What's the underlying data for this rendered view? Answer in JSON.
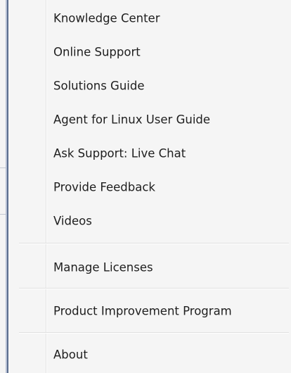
{
  "menu": {
    "groups": [
      {
        "items": [
          {
            "label": "Knowledge Center"
          },
          {
            "label": "Online Support"
          },
          {
            "label": "Solutions Guide"
          },
          {
            "label": "Agent for Linux User Guide"
          },
          {
            "label": "Ask Support: Live Chat"
          },
          {
            "label": "Provide Feedback"
          },
          {
            "label": "Videos"
          }
        ]
      },
      {
        "items": [
          {
            "label": "Manage Licenses"
          }
        ]
      },
      {
        "items": [
          {
            "label": "Product Improvement Program"
          }
        ]
      },
      {
        "items": [
          {
            "label": "About"
          }
        ]
      }
    ]
  },
  "colors": {
    "menu_background": "#f5f5f5",
    "text": "#1e1e1e",
    "separator": "#e0e0e0",
    "window_edge": "#5a6c8c"
  }
}
